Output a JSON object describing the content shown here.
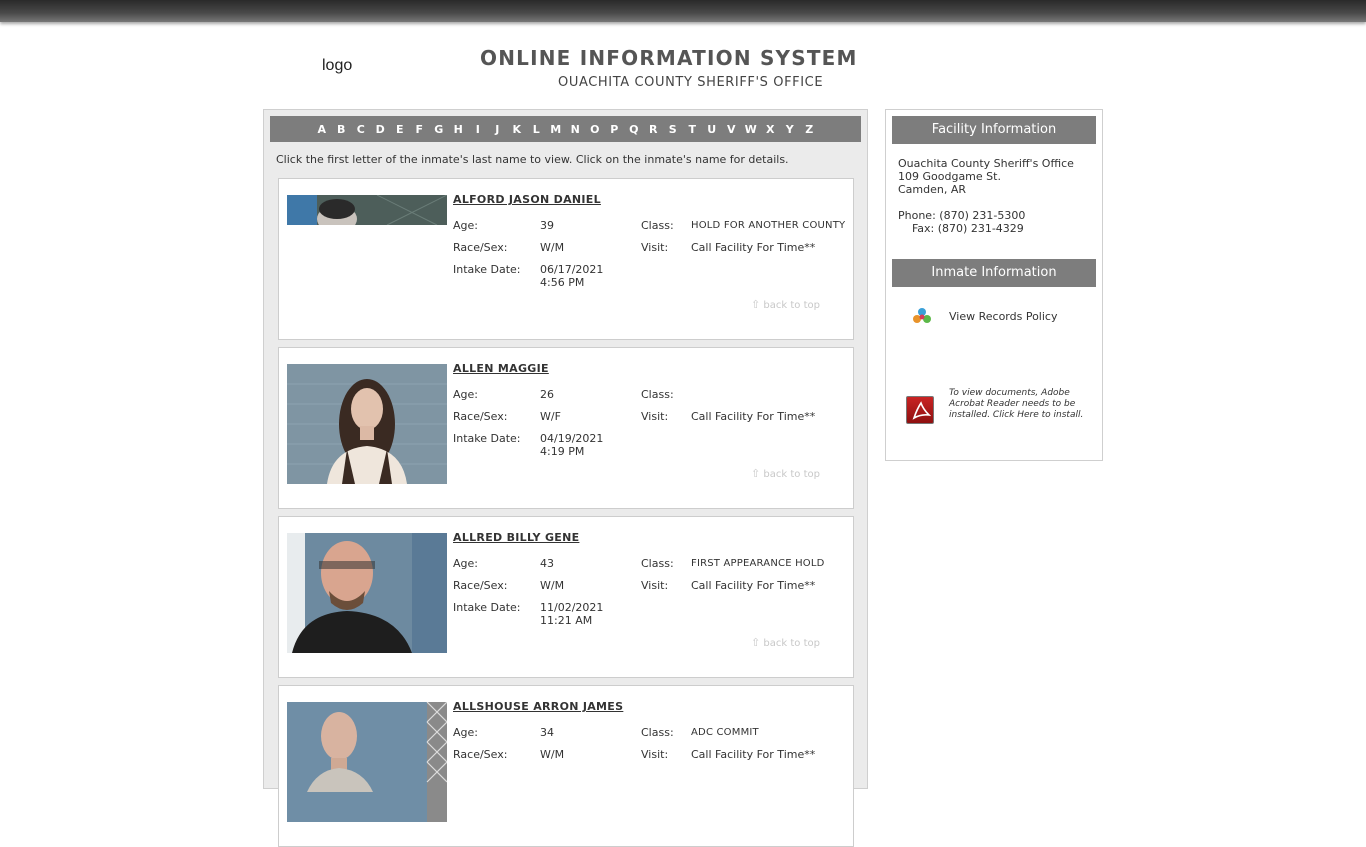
{
  "header": {
    "logo_alt": "logo",
    "title": "ONLINE INFORMATION SYSTEM",
    "subtitle": "OUACHITA COUNTY SHERIFF'S OFFICE"
  },
  "alphabet": [
    "A",
    "B",
    "C",
    "D",
    "E",
    "F",
    "G",
    "H",
    "I",
    "J",
    "K",
    "L",
    "M",
    "N",
    "O",
    "P",
    "Q",
    "R",
    "S",
    "T",
    "U",
    "V",
    "W",
    "X",
    "Y",
    "Z"
  ],
  "instructions": "Click the first letter of the inmate's last name to view.  Click on the inmate's name for details.",
  "labels": {
    "age": "Age:",
    "race_sex": "Race/Sex:",
    "intake_date": "Intake Date:",
    "class": "Class:",
    "visit": "Visit:",
    "back_to_top": "back to top"
  },
  "inmates": [
    {
      "name": "ALFORD JASON DANIEL",
      "age": "39",
      "race_sex": "W/M",
      "intake_date": "06/17/2021",
      "intake_time": "4:56 PM",
      "class": "HOLD FOR ANOTHER COUNTY",
      "visit": "Call Facility For Time**"
    },
    {
      "name": "ALLEN MAGGIE",
      "age": "26",
      "race_sex": "W/F",
      "intake_date": "04/19/2021",
      "intake_time": "4:19 PM",
      "class": "",
      "visit": "Call Facility For Time**"
    },
    {
      "name": "ALLRED BILLY GENE",
      "age": "43",
      "race_sex": "W/M",
      "intake_date": "11/02/2021",
      "intake_time": "11:21 AM",
      "class": "FIRST APPEARANCE HOLD",
      "visit": "Call Facility For Time**"
    },
    {
      "name": "ALLSHOUSE ARRON JAMES",
      "age": "34",
      "race_sex": "W/M",
      "intake_date": "",
      "intake_time": "",
      "class": "ADC COMMIT",
      "visit": "Call Facility For Time**"
    }
  ],
  "sidebar": {
    "facility_heading": "Facility Information",
    "facility_address": "Ouachita County Sheriff's Office\n109 Goodgame St.\nCamden, AR",
    "facility_phone": "Phone: (870) 231-5300\n    Fax: (870) 231-4329",
    "inmate_heading": "Inmate Information",
    "records_link": "View Records Policy",
    "pdf_note": "To view documents, Adobe Acrobat Reader needs to be installed. Click Here to install."
  },
  "colors": {
    "header_bar": "#7d7d7d",
    "panel_bg": "#ebebeb"
  }
}
